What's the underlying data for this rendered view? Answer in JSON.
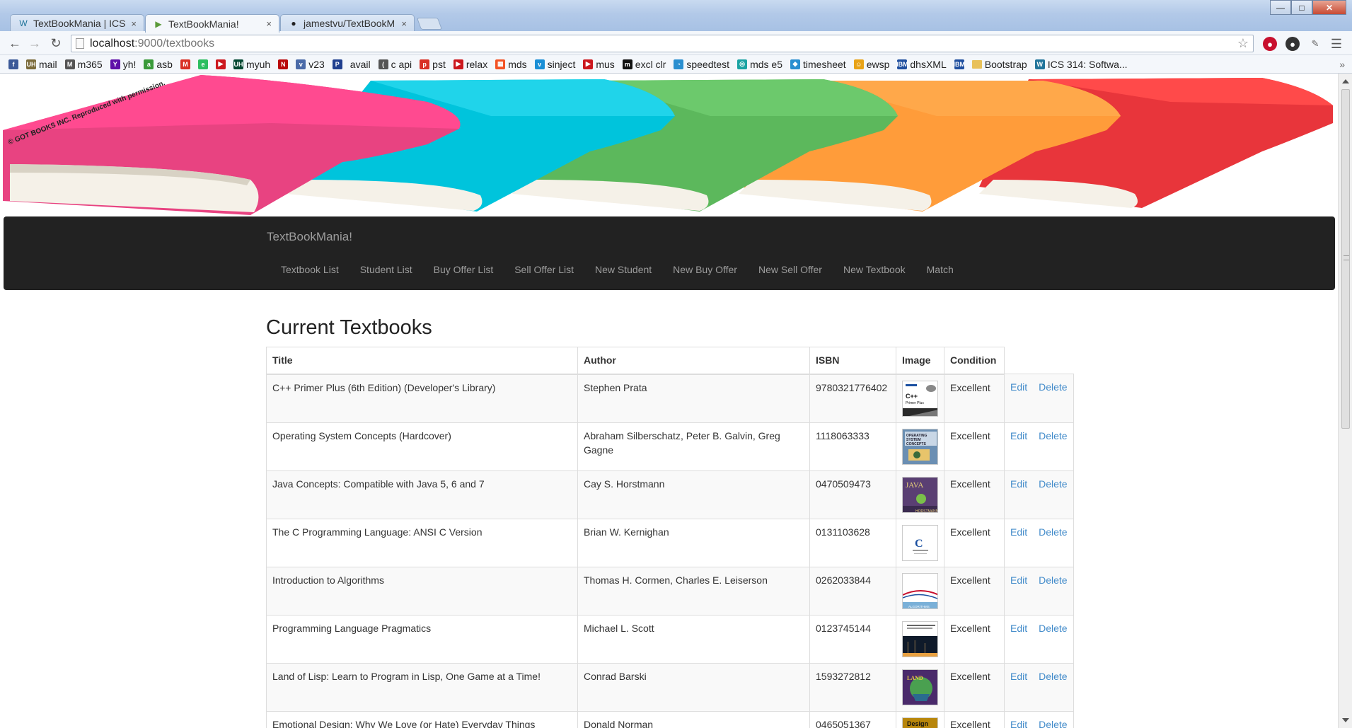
{
  "browser": {
    "tabs": [
      {
        "label": "TextBookMania | ICS",
        "active": false,
        "icon": "wordpress-icon"
      },
      {
        "label": "TextBookMania!",
        "active": true,
        "icon": "play-icon"
      },
      {
        "label": "jamestvu/TextBookM",
        "active": false,
        "icon": "github-icon"
      }
    ],
    "url_host": "localhost",
    "url_path": ":9000/textbooks",
    "bookmarks": [
      {
        "label": "",
        "icon": "facebook-icon",
        "color": "#3b5998",
        "glyph": "f"
      },
      {
        "label": "mail",
        "icon": "uh-icon",
        "color": "#7a6a3a",
        "glyph": "UH"
      },
      {
        "label": "m365",
        "icon": "m365-icon",
        "color": "#555555",
        "glyph": "M"
      },
      {
        "label": "yh!",
        "icon": "yahoo-icon",
        "color": "#5f0ea8",
        "glyph": "Y"
      },
      {
        "label": "asb",
        "icon": "asb-icon",
        "color": "#3a9a3a",
        "glyph": "a"
      },
      {
        "label": "",
        "icon": "gmail-icon",
        "color": "#d93025",
        "glyph": "M"
      },
      {
        "label": "",
        "icon": "evernote-icon",
        "color": "#2dbe60",
        "glyph": "e"
      },
      {
        "label": "",
        "icon": "youtube-icon",
        "color": "#cc181e",
        "glyph": "▶"
      },
      {
        "label": "myuh",
        "icon": "uh-icon",
        "color": "#024731",
        "glyph": "UH"
      },
      {
        "label": "",
        "icon": "netflix-icon",
        "color": "#b9090b",
        "glyph": "N"
      },
      {
        "label": "v23",
        "icon": "v23-icon",
        "color": "#4a6aa8",
        "glyph": "v"
      },
      {
        "label": "",
        "icon": "p-icon",
        "color": "#1f3f8f",
        "glyph": "P"
      },
      {
        "label": "avail",
        "icon": "",
        "color": "#f4f7fb",
        "glyph": ""
      },
      {
        "label": "c api",
        "icon": "capi-icon",
        "color": "#555555",
        "glyph": "("
      },
      {
        "label": "pst",
        "icon": "pst-icon",
        "color": "#d93025",
        "glyph": "p"
      },
      {
        "label": "relax",
        "icon": "youtube-icon",
        "color": "#cc181e",
        "glyph": "▶"
      },
      {
        "label": "mds",
        "icon": "windows-icon",
        "color": "#f35325",
        "glyph": "▦"
      },
      {
        "label": "sinject",
        "icon": "v-icon",
        "color": "#1a8fd6",
        "glyph": "v"
      },
      {
        "label": "mus",
        "icon": "youtube-icon",
        "color": "#cc181e",
        "glyph": "▶"
      },
      {
        "label": "excl clr",
        "icon": "m-icon",
        "color": "#111111",
        "glyph": "m"
      },
      {
        "label": "speedtest",
        "icon": "speedtest-icon",
        "color": "#2a8fd0",
        "glyph": "◔"
      },
      {
        "label": "mds e5",
        "icon": "mds-icon",
        "color": "#1aa3a3",
        "glyph": "◎"
      },
      {
        "label": "timesheet",
        "icon": "timesheet-icon",
        "color": "#2a8fd0",
        "glyph": "◆"
      },
      {
        "label": "ewsp",
        "icon": "ewsp-icon",
        "color": "#e8a317",
        "glyph": "☺"
      },
      {
        "label": "dhsXML",
        "icon": "ibm-icon",
        "color": "#1f4f9f",
        "glyph": "IBM"
      },
      {
        "label": "",
        "icon": "ibm-icon",
        "color": "#1f4f9f",
        "glyph": "IBM"
      },
      {
        "label": "Bootstrap",
        "icon": "folder-icon",
        "color": "#e8c15a",
        "glyph": ""
      },
      {
        "label": "ICS 314: Softwa...",
        "icon": "wordpress-icon",
        "color": "#21759b",
        "glyph": "W"
      }
    ]
  },
  "page": {
    "brand": "TextBookMania!",
    "copyright": "© GOT BOOKS INC. Reproduced with permission.",
    "nav": [
      "Textbook List",
      "Student List",
      "Buy Offer List",
      "Sell Offer List",
      "New Student",
      "New Buy Offer",
      "New Sell Offer",
      "New Textbook",
      "Match"
    ],
    "heading": "Current Textbooks",
    "columns": [
      "Title",
      "Author",
      "ISBN",
      "Image",
      "Condition"
    ],
    "edit_label": "Edit",
    "delete_label": "Delete",
    "books": [
      {
        "title": "C++ Primer Plus (6th Edition) (Developer's Library)",
        "author": "Stephen Prata",
        "isbn": "9780321776402",
        "condition": "Excellent",
        "cover": "cpp"
      },
      {
        "title": "Operating System Concepts (Hardcover)",
        "author": "Abraham Silberschatz, Peter B. Galvin, Greg Gagne",
        "isbn": "1118063333",
        "condition": "Excellent",
        "cover": "os"
      },
      {
        "title": "Java Concepts: Compatible with Java 5, 6 and 7",
        "author": "Cay S. Horstmann",
        "isbn": "0470509473",
        "condition": "Excellent",
        "cover": "java"
      },
      {
        "title": "The C Programming Language: ANSI C Version",
        "author": "Brian W. Kernighan",
        "isbn": "0131103628",
        "condition": "Excellent",
        "cover": "c"
      },
      {
        "title": "Introduction to Algorithms",
        "author": "Thomas H. Cormen, Charles E. Leiserson",
        "isbn": "0262033844",
        "condition": "Excellent",
        "cover": "algo"
      },
      {
        "title": "Programming Language Pragmatics",
        "author": "Michael L. Scott",
        "isbn": "0123745144",
        "condition": "Excellent",
        "cover": "plp"
      },
      {
        "title": "Land of Lisp: Learn to Program in Lisp, One Game at a Time!",
        "author": "Conrad Barski",
        "isbn": "1593272812",
        "condition": "Excellent",
        "cover": "lisp"
      },
      {
        "title": "Emotional Design: Why We Love (or Hate) Everyday Things",
        "author": "Donald Norman",
        "isbn": "0465051367",
        "condition": "Excellent",
        "cover": "design"
      }
    ]
  }
}
